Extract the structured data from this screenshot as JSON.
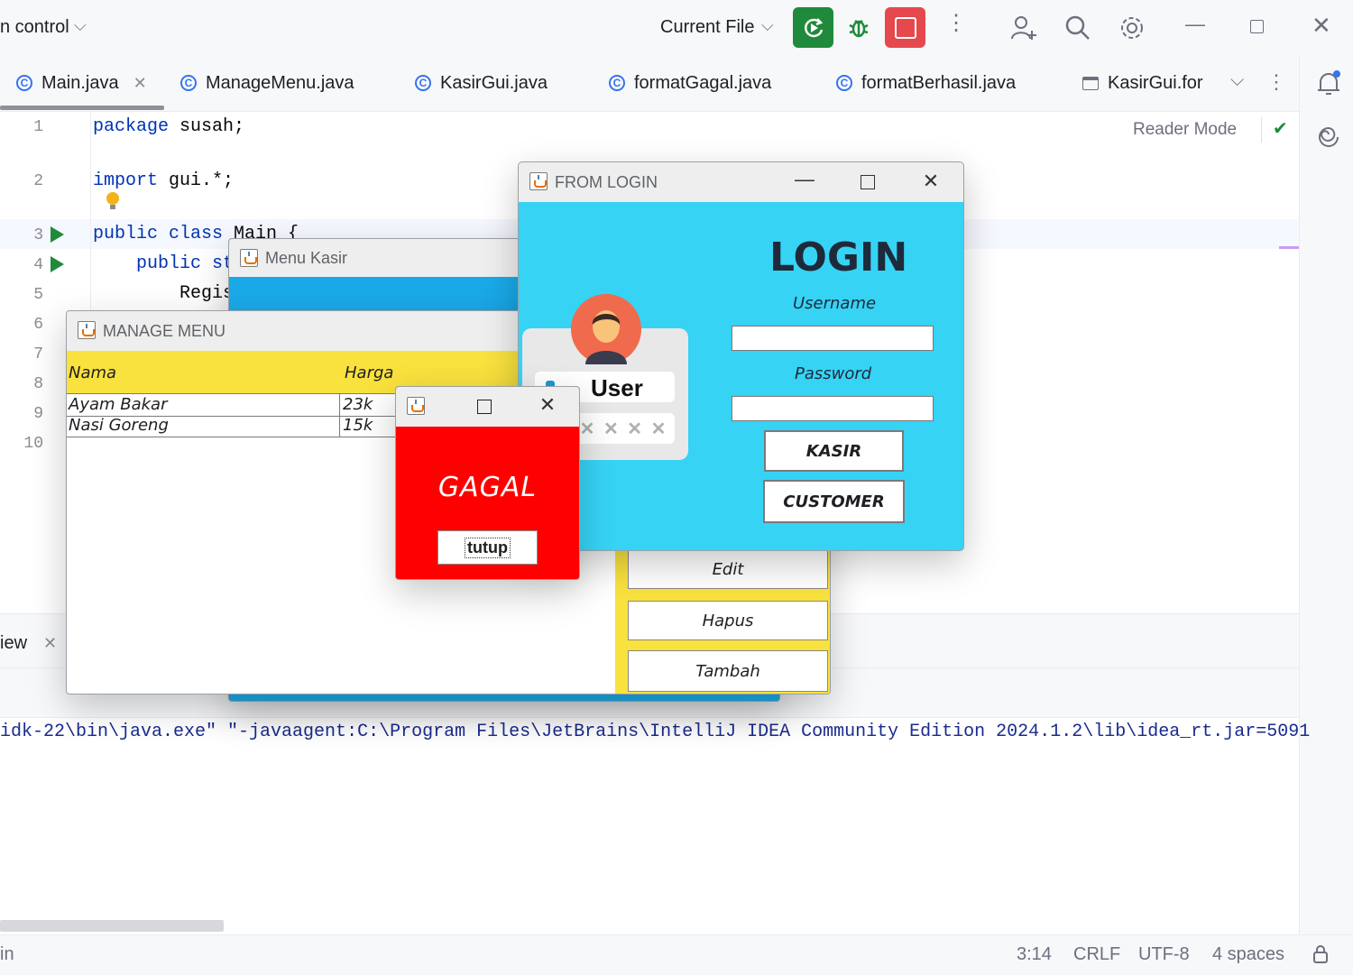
{
  "toolbar": {
    "project_name": "n control",
    "run_config": "Current File",
    "chevron": "⌄"
  },
  "tabs": [
    {
      "label": "Main.java"
    },
    {
      "label": "ManageMenu.java"
    },
    {
      "label": "KasirGui.java"
    },
    {
      "label": "formatGagal.java"
    },
    {
      "label": "formatBerhasil.java"
    },
    {
      "label": "KasirGui.for"
    }
  ],
  "editor": {
    "reader_mode": "Reader Mode",
    "line_numbers": [
      "1",
      "2",
      "3",
      "4",
      "5",
      "6",
      "7",
      "8",
      "9",
      "10"
    ],
    "lines": {
      "l1_kw": "package",
      "l1_rest": " susah;",
      "l2_kw": "import",
      "l2_rest": " gui.*;",
      "l3_kw": "public class",
      "l3_rest": " Main {",
      "l4_kw": "public st",
      "l5_rest": "Regis"
    }
  },
  "bottom_panel": {
    "tab_label": "iew",
    "console_line": "idk-22\\bin\\java.exe\" \"-javaagent:C:\\Program Files\\JetBrains\\IntelliJ IDEA Community Edition 2024.1.2\\lib\\idea_rt.jar=5091"
  },
  "status_bar": {
    "left_text": "in",
    "position": "3:14",
    "line_ending": "CRLF",
    "encoding": "UTF-8",
    "indent": "4 spaces"
  },
  "menu_kasir_window": {
    "title": "Menu Kasir"
  },
  "manage_menu_window": {
    "title": "MANAGE MENU",
    "columns": [
      "Nama",
      "Harga"
    ],
    "rows": [
      {
        "nama": "Ayam Bakar",
        "harga": "23k"
      },
      {
        "nama": "Nasi Goreng",
        "harga": "15k"
      }
    ],
    "buttons": {
      "edit": "Edit",
      "hapus": "Hapus",
      "tambah": "Tambah"
    }
  },
  "gagal_dialog": {
    "message": "GAGAL",
    "close_label": "tutup"
  },
  "login_window": {
    "title": "FROM LOGIN",
    "heading": "LOGIN",
    "username_label": "Username",
    "password_label": "Password",
    "username_value": "",
    "password_value": "",
    "user_card_label": "User",
    "user_card_mask": "✕ ✕ ✕ ✕",
    "kasir_label": "KASIR",
    "customer_label": "CUSTOMER"
  },
  "colors": {
    "login_bg": "#36d3f5",
    "table_header": "#f9e13e",
    "gagal_bg": "#ff0000",
    "run_green": "#208a3c",
    "stop_red": "#e5484d",
    "menu_kasir_blue": "#1aa9e8"
  }
}
